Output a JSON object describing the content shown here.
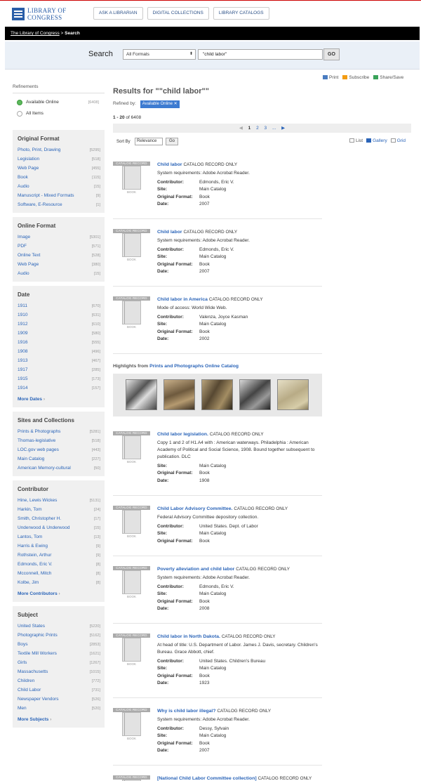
{
  "header": {
    "logo_line1": "LIBRARY OF",
    "logo_line2": "CONGRESS",
    "nav": [
      "ASK A LIBRARIAN",
      "DIGITAL COLLECTIONS",
      "LIBRARY CATALOGS"
    ]
  },
  "breadcrumb": {
    "home": "The Library of Congress",
    "sep": " > ",
    "current": "Search"
  },
  "search": {
    "label": "Search",
    "format": "All Formats",
    "query": "\"child labor\"",
    "go": "GO"
  },
  "utilities": [
    "Print",
    "Subscribe",
    "Share/Save"
  ],
  "refinements": {
    "title": "Refinements",
    "options": [
      {
        "label": "Available Online",
        "count": "[6408]",
        "selected": true
      },
      {
        "label": "All Items",
        "count": "",
        "selected": false
      }
    ]
  },
  "facets": [
    {
      "title": "Original Format",
      "items": [
        {
          "label": "Photo, Print, Drawing",
          "count": "[5295]"
        },
        {
          "label": "Legislation",
          "count": "[518]"
        },
        {
          "label": "Web Page",
          "count": "[455]"
        },
        {
          "label": "Book",
          "count": "[115]"
        },
        {
          "label": "Audio",
          "count": "[15]"
        },
        {
          "label": "Manuscript - Mixed Formats",
          "count": "[9]"
        },
        {
          "label": "Software, E-Resource",
          "count": "[1]"
        }
      ],
      "more": ""
    },
    {
      "title": "Online Format",
      "items": [
        {
          "label": "Image",
          "count": "[5301]"
        },
        {
          "label": "PDF",
          "count": "[571]"
        },
        {
          "label": "Online Text",
          "count": "[528]"
        },
        {
          "label": "Web Page",
          "count": "[380]"
        },
        {
          "label": "Audio",
          "count": "[15]"
        }
      ],
      "more": ""
    },
    {
      "title": "Date",
      "items": [
        {
          "label": "1911",
          "count": "[670]"
        },
        {
          "label": "1910",
          "count": "[631]"
        },
        {
          "label": "1912",
          "count": "[610]"
        },
        {
          "label": "1909",
          "count": "[580]"
        },
        {
          "label": "1916",
          "count": "[555]"
        },
        {
          "label": "1908",
          "count": "[496]"
        },
        {
          "label": "1913",
          "count": "[467]"
        },
        {
          "label": "1917",
          "count": "[285]"
        },
        {
          "label": "1915",
          "count": "[173]"
        },
        {
          "label": "1914",
          "count": "[157]"
        }
      ],
      "more": "More Dates"
    },
    {
      "title": "Sites and Collections",
      "items": [
        {
          "label": "Prints & Photographs",
          "count": "[5281]"
        },
        {
          "label": "Thomas-legislative",
          "count": "[518]"
        },
        {
          "label": "LOC.gov web pages",
          "count": "[443]"
        },
        {
          "label": "Main Catalog",
          "count": "[227]"
        },
        {
          "label": "American Memory-cultural",
          "count": "[50]"
        }
      ],
      "more": ""
    },
    {
      "title": "Contributor",
      "items": [
        {
          "label": "Hine, Lewis Wickes",
          "count": "[5131]"
        },
        {
          "label": "Harkin, Tom",
          "count": "[24]"
        },
        {
          "label": "Smith, Christopher H.",
          "count": "[17]"
        },
        {
          "label": "Underwood & Underwood",
          "count": "[15]"
        },
        {
          "label": "Lantos, Tom",
          "count": "[13]"
        },
        {
          "label": "Harris & Ewing",
          "count": "[9]"
        },
        {
          "label": "Rothstein, Arthur",
          "count": "[9]"
        },
        {
          "label": "Edmonds, Eric V.",
          "count": "[8]"
        },
        {
          "label": "Mcconnell, Mitch",
          "count": "[8]"
        },
        {
          "label": "Kolbe, Jim",
          "count": "[8]"
        }
      ],
      "more": "More Contributors"
    },
    {
      "title": "Subject",
      "items": [
        {
          "label": "United States",
          "count": "[5220]"
        },
        {
          "label": "Photographic Prints",
          "count": "[5162]"
        },
        {
          "label": "Boys",
          "count": "[2853]"
        },
        {
          "label": "Textile Mill Workers",
          "count": "[1621]"
        },
        {
          "label": "Girls",
          "count": "[1267]"
        },
        {
          "label": "Massachusetts",
          "count": "[1015]"
        },
        {
          "label": "Children",
          "count": "[772]"
        },
        {
          "label": "Child Labor",
          "count": "[731]"
        },
        {
          "label": "Newspaper Vendors",
          "count": "[526]"
        },
        {
          "label": "Men",
          "count": "[520]"
        }
      ],
      "more": "More Subjects"
    }
  ],
  "main": {
    "title": "Results for \"\"child labor\"\"",
    "refined_by": "Refined by:",
    "chip": "Available Online",
    "count_range": "1 - 20",
    "count_total": " of 6408",
    "pager": {
      "prev": "◀",
      "pages": [
        "1",
        "2",
        "3"
      ],
      "ellipsis": "...",
      "next": "▶"
    },
    "sort_label": "Sort By",
    "sort_value": "Relevance",
    "sort_go": "Go",
    "views": [
      "List",
      "Gallery",
      "Grid"
    ]
  },
  "thumb": {
    "ribbon": "CATALOG RECORD",
    "label": "BOOK"
  },
  "highlights": {
    "prefix": "Highlights from ",
    "link": "Prints and Photographs Online Catalog"
  },
  "results": [
    {
      "title": "Child labor",
      "tag": "CATALOG RECORD ONLY",
      "desc": "System requirements: Adobe Acrobat Reader.",
      "meta": [
        [
          "Contributor:",
          "Edmonds, Eric V."
        ],
        [
          "Site:",
          "Main Catalog"
        ],
        [
          "Original Format:",
          "Book"
        ],
        [
          "Date:",
          "2007"
        ]
      ]
    },
    {
      "title": "Child labor",
      "tag": "CATALOG RECORD ONLY",
      "desc": "System requirements: Adobe Acrobat Reader.",
      "meta": [
        [
          "Contributor:",
          "Edmonds, Eric V."
        ],
        [
          "Site:",
          "Main Catalog"
        ],
        [
          "Original Format:",
          "Book"
        ],
        [
          "Date:",
          "2007"
        ]
      ]
    },
    {
      "title": "Child labor in America",
      "tag": "CATALOG RECORD ONLY",
      "desc": "Mode of access: World Wide Web.",
      "meta": [
        [
          "Contributor:",
          "Valenza, Joyce Kasman"
        ],
        [
          "Site:",
          "Main Catalog"
        ],
        [
          "Original Format:",
          "Book"
        ],
        [
          "Date:",
          "2002"
        ]
      ]
    },
    {
      "title": "Child labor legislation.",
      "tag": "CATALOG RECORD ONLY",
      "desc": "Copy 1 and 2 of H1.A4 with : American waterways. Philadelphia : American Academy of Political and Social Science, 1908. Bound together subsequent to publication. DLC",
      "meta": [
        [
          "Site:",
          "Main Catalog"
        ],
        [
          "Original Format:",
          "Book"
        ],
        [
          "Date:",
          "1908"
        ]
      ]
    },
    {
      "title": "Child Labor Advisory Committee.",
      "tag": "CATALOG RECORD ONLY",
      "desc": "Federal Advisory Committee depository collection.",
      "meta": [
        [
          "Contributor:",
          "United States. Dept. of Labor"
        ],
        [
          "Site:",
          "Main Catalog"
        ],
        [
          "Original Format:",
          "Book"
        ]
      ]
    },
    {
      "title": "Poverty alleviation and child labor",
      "tag": "CATALOG RECORD ONLY",
      "desc": "System requirements: Adobe Acrobat Reader.",
      "meta": [
        [
          "Contributor:",
          "Edmonds, Eric V."
        ],
        [
          "Site:",
          "Main Catalog"
        ],
        [
          "Original Format:",
          "Book"
        ],
        [
          "Date:",
          "2008"
        ]
      ]
    },
    {
      "title": "Child labor in North Dakota.",
      "tag": "CATALOG RECORD ONLY",
      "desc": "At head of title: U.S. Department of Labor. James J. Davis, secretary. Children's Bureau. Grace Abbott, chief.",
      "meta": [
        [
          "Contributor:",
          "United States. Children's Bureau"
        ],
        [
          "Site:",
          "Main Catalog"
        ],
        [
          "Original Format:",
          "Book"
        ],
        [
          "Date:",
          "1923"
        ]
      ]
    },
    {
      "title": "Why is child labor illegal?",
      "tag": "CATALOG RECORD ONLY",
      "desc": "System requirements: Adobe Acrobat Reader.",
      "meta": [
        [
          "Contributor:",
          "Dessy, Sylvain"
        ],
        [
          "Site:",
          "Main Catalog"
        ],
        [
          "Original Format:",
          "Book"
        ],
        [
          "Date:",
          "2007"
        ]
      ]
    },
    {
      "title": "[National Child Labor Committee collection]",
      "tag": "CATALOG RECORD ONLY",
      "desc": "",
      "meta": []
    }
  ]
}
